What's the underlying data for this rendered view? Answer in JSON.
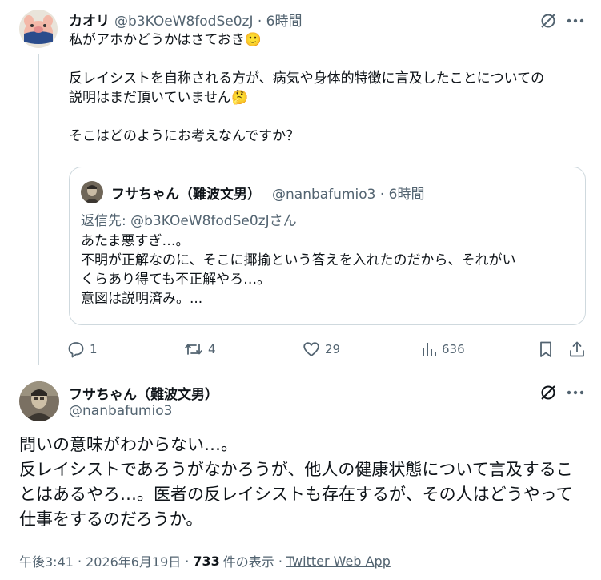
{
  "reply_tweet": {
    "display_name": "カオリ",
    "handle_time": "@b3KOeW8fodSe0zJ · 6時間",
    "paragraphs": [
      "私がアホかどうかはさておき🙂",
      "反レイシストを自称される方が、病気や身体的特徴に言及したことについての\n説明はまだ頂いていません🤔",
      "そこはどのようにお考えなんですか？"
    ],
    "quote": {
      "display_name": "フサちゃん（難波文男）",
      "handle_time": "@nanbafumio3 · 6時間",
      "reply_to": "返信先: @b3KOeW8fodSe0zJさん",
      "lines": [
        "あたま悪すぎ…。",
        "不明が正解なのに、そこに揶揄という答えを入れたのだから、それがい",
        "くらあり得ても不正解やろ…。",
        "意図は説明済み。..."
      ]
    },
    "actions": {
      "reply_count": "1",
      "retweet_count": "4",
      "like_count": "29",
      "views_count": "636"
    }
  },
  "main_tweet": {
    "display_name": "フサちゃん（難波文男）",
    "handle": "@nanbafumio3",
    "lines": [
      "問いの意味がわからない…。",
      "反レイシストであろうがなかろうが、他人の健康状態について言及するこ",
      "とはあるやろ…。医者の反レイシストも存在するが、その人はどうやって",
      "仕事をするのだろうか。"
    ],
    "meta": {
      "time": "午後3:41",
      "date": "2026年6月19日",
      "views_number": "733",
      "views_label": "件の表示",
      "source": "Twitter Web App",
      "separator": "·"
    }
  },
  "colors": {
    "text": "#0f1419",
    "secondary": "#536471",
    "border": "#cfd9de"
  }
}
